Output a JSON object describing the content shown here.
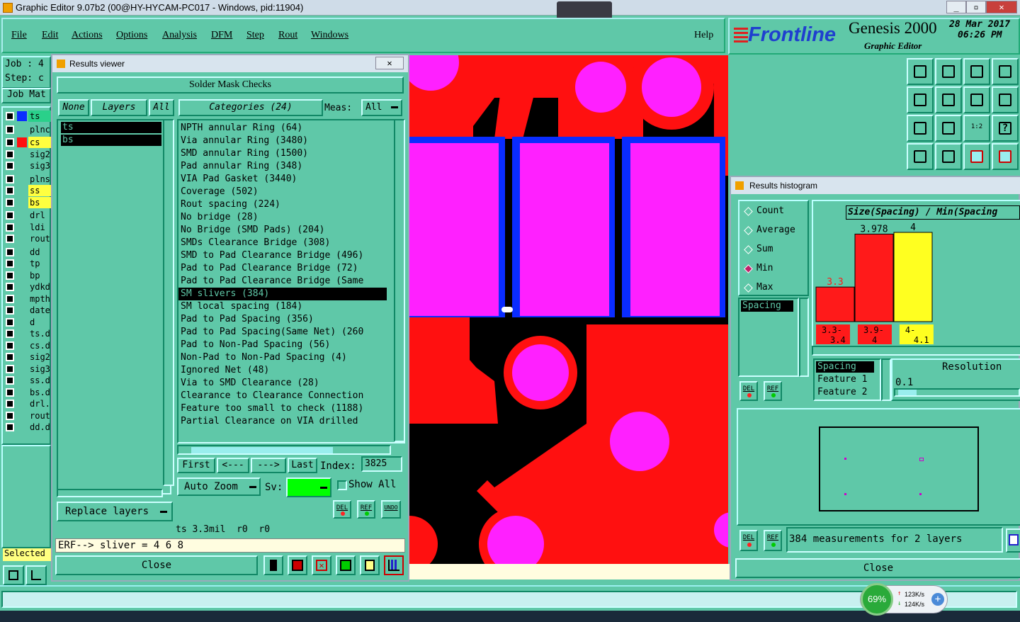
{
  "window": {
    "title": "Graphic Editor 9.07b2 (00@HY-HYCAM-PC017 - Windows, pid:11904)"
  },
  "menu": [
    "File",
    "Edit",
    "Actions",
    "Options",
    "Analysis",
    "DFM",
    "Step",
    "Rout",
    "Windows"
  ],
  "help": "Help",
  "logo": {
    "brand": "Frontline",
    "product": "Genesis 2000",
    "subtitle": "Graphic Editor",
    "date": "28 Mar 2017",
    "time": "06:26 PM"
  },
  "left": {
    "job": "Job : 4",
    "step": "Step: c",
    "job_matrix": "Job Mat",
    "selected": "Selected"
  },
  "layers": [
    {
      "name": "ts",
      "color": "#0a2cff",
      "active": true
    },
    {
      "name": "plnc",
      "color": "#000"
    },
    {
      "name": "cs",
      "color": "#ff1010"
    },
    {
      "name": "sig2",
      "color": "#000"
    },
    {
      "name": "sig3",
      "color": "#000"
    },
    {
      "name": "plns",
      "color": "#000"
    },
    {
      "name": "ss",
      "color": "#000"
    },
    {
      "name": "bs",
      "color": "#000"
    },
    {
      "name": "drl",
      "color": "#000"
    },
    {
      "name": "ldi",
      "color": "#000"
    },
    {
      "name": "rout",
      "color": "#000"
    },
    {
      "name": "dd",
      "color": "#000"
    },
    {
      "name": "tp",
      "color": "#000"
    },
    {
      "name": "bp",
      "color": "#000"
    },
    {
      "name": "ydkd",
      "color": "#000"
    },
    {
      "name": "mpth",
      "color": "#000"
    },
    {
      "name": "date",
      "color": "#000"
    },
    {
      "name": "d",
      "color": "#000"
    },
    {
      "name": "ts.d",
      "color": "#000"
    },
    {
      "name": "cs.d",
      "color": "#000"
    },
    {
      "name": "sig2",
      "color": "#000"
    },
    {
      "name": "sig3",
      "color": "#000"
    },
    {
      "name": "ss.d",
      "color": "#000"
    },
    {
      "name": "bs.d",
      "color": "#000"
    },
    {
      "name": "drl.",
      "color": "#000"
    },
    {
      "name": "rout",
      "color": "#000"
    },
    {
      "name": "dd.d",
      "color": "#000"
    }
  ],
  "results_viewer": {
    "title": "Results viewer",
    "header": "Solder Mask Checks",
    "none_btn": "None",
    "layers_btn": "Layers",
    "all_btn": "All",
    "categories_btn": "Categories (24)",
    "meas_label": "Meas:",
    "meas_value": "All",
    "layer_list": [
      "ts",
      "bs"
    ],
    "categories": [
      "NPTH annular Ring (64)",
      "Via annular Ring (3480)",
      "SMD annular Ring (1500)",
      "Pad annular Ring (348)",
      "VIA Pad Gasket (3440)",
      "Coverage (502)",
      "Rout spacing (224)",
      "No bridge (28)",
      "No Bridge (SMD Pads) (204)",
      "SMDs Clearance Bridge (308)",
      "SMD to Pad Clearance Bridge (496)",
      "Pad to Pad Clearance Bridge (72)",
      "Pad to Pad Clearance Bridge (Same",
      "SM slivers (384)",
      "SM local spacing (184)",
      "Pad to Pad Spacing (356)",
      "Pad to Pad Spacing(Same Net) (260",
      "Pad to Non-Pad Spacing (56)",
      "Non-Pad to Non-Pad Spacing (4)",
      "Ignored Net (48)",
      "Via to SMD Clearance (28)",
      "Clearance to Clearance Connection",
      "Feature too small to check (1188)",
      "Partial Clearance on VIA drilled"
    ],
    "selected_category": "SM slivers (384)",
    "first": "First",
    "prev": "<---",
    "next": "--->",
    "last": "Last",
    "index_label": "Index:",
    "index_value": "3825",
    "auto_zoom": "Auto Zoom",
    "sv_label": "Sv:",
    "show_all": "Show All",
    "replace_layers": "Replace layers",
    "del": "DEL",
    "ref": "REF",
    "undo": "UNDO",
    "info": "ts 3.3mil  r0  r0",
    "erf": "ERF--> sliver = 4 6 8",
    "close": "Close"
  },
  "histogram": {
    "title": "Results histogram",
    "modes": [
      "Count",
      "Average",
      "Sum",
      "Min",
      "Max"
    ],
    "selected_mode": "Min",
    "measure_list": [
      "Spacing"
    ],
    "chart_title": "Size(Spacing) / Min(Spacing",
    "del": "DEL",
    "ref": "REF",
    "bins": [
      {
        "label_top": "3.3-",
        "label_bot": "3.4",
        "value": "3.3",
        "color": "#ff1a1a"
      },
      {
        "label_top": "3.9-",
        "label_bot": "4",
        "value": "3.978",
        "color": "#ff1a1a"
      },
      {
        "label_top": "4-",
        "label_bot": "4.1",
        "value": "4",
        "color": "#ffff20"
      }
    ],
    "attr_list": [
      "Spacing",
      "Feature 1",
      "Feature 2"
    ],
    "resolution_label": "Resolution",
    "resolution_value": "0.1",
    "measurements": "384 measurements for 2 layers",
    "close": "Close"
  },
  "chart_data": {
    "type": "bar",
    "title": "Size(Spacing) / Min(Spacing",
    "categories": [
      "3.3-3.4",
      "3.9-4",
      "4-4.1"
    ],
    "values": [
      3.3,
      3.978,
      4
    ],
    "ylim": [
      0,
      4
    ]
  },
  "taskbar": {
    "cpu": "69%",
    "up": "123K/s",
    "down": "124K/s"
  }
}
